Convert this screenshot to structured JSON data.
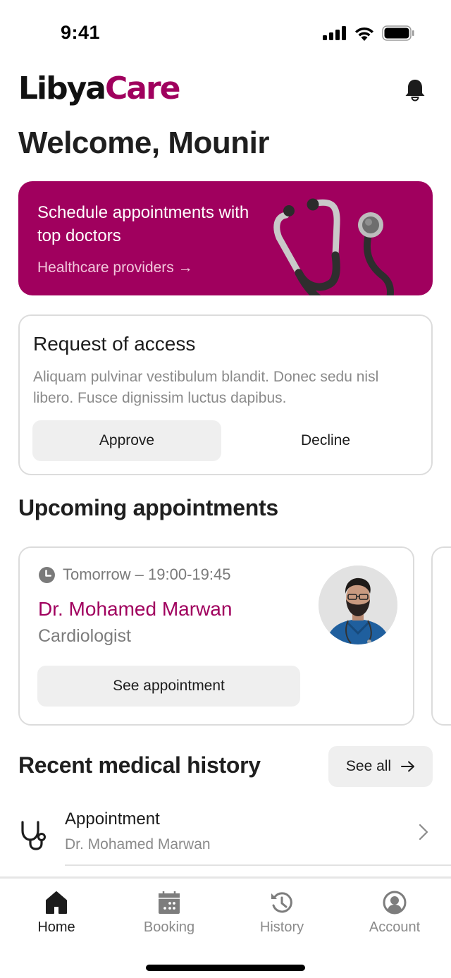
{
  "status_bar": {
    "time": "9:41",
    "icons": [
      "signal-icon",
      "wifi-icon",
      "battery-icon"
    ]
  },
  "header": {
    "logo": {
      "part1": "Libya",
      "part2": "Care"
    },
    "notification_icon": "bell-icon"
  },
  "welcome": "Welcome, Mounir",
  "promo": {
    "title": "Schedule appointments with top doctors",
    "link": "Healthcare providers →",
    "image": "stethoscope-illustration"
  },
  "access_request": {
    "title": "Request of access",
    "description": "Aliquam pulvinar vestibulum blandit. Donec sedu nisl libero. Fusce dignissim luctus dapibus.",
    "approve_label": "Approve",
    "decline_label": "Decline"
  },
  "upcoming": {
    "title": "Upcoming appointments",
    "appointments": [
      {
        "time": "Tomorrow – 19:00-19:45",
        "doctor": "Dr. Mohamed Marwan",
        "specialty": "Cardiologist",
        "button_label": "See appointment",
        "avatar": "doctor-photo"
      }
    ]
  },
  "history": {
    "title": "Recent medical history",
    "see_all_label": "See all",
    "items": [
      {
        "label": "Appointment",
        "sub": "Dr. Mohamed Marwan",
        "icon": "stethoscope-icon"
      }
    ]
  },
  "tab_bar": {
    "active": "Home",
    "tabs": [
      {
        "label": "Home",
        "icon": "home-icon"
      },
      {
        "label": "Booking",
        "icon": "calendar-icon"
      },
      {
        "label": "History",
        "icon": "history-icon"
      },
      {
        "label": "Account",
        "icon": "account-icon"
      }
    ]
  },
  "colors": {
    "brand": "#a0005e",
    "text": "#1c1c1c",
    "muted": "#8a8a8a",
    "button_bg": "#efefef"
  }
}
